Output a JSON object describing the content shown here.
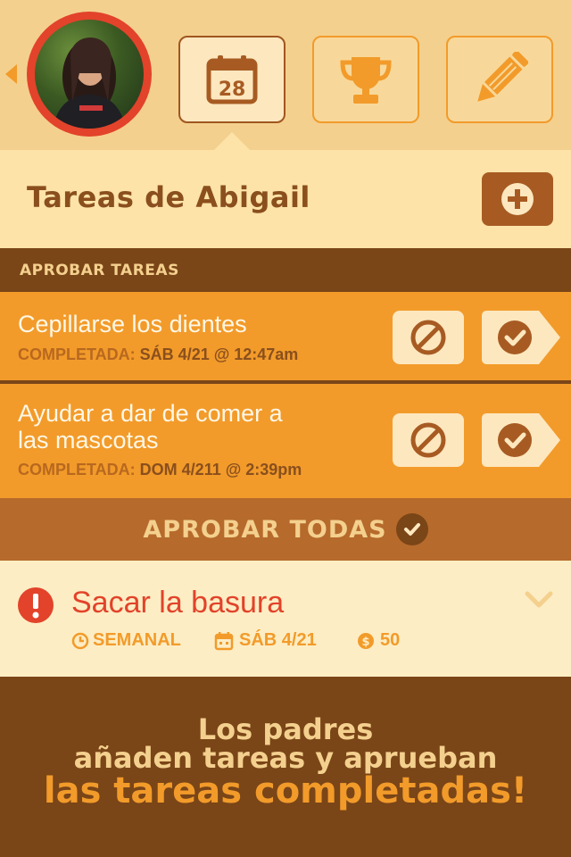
{
  "header": {
    "tabs": [
      {
        "name": "calendar",
        "icon": "calendar-icon",
        "badge": "28",
        "active": true
      },
      {
        "name": "trophy",
        "icon": "trophy-icon",
        "active": false
      },
      {
        "name": "edit",
        "icon": "pencil-icon",
        "active": false
      }
    ],
    "avatar": {
      "icon": "avatar-photo"
    }
  },
  "page": {
    "title": "Tareas de Abigail",
    "add_icon": "plus-circle-icon"
  },
  "section": {
    "label": "APROBAR TAREAS"
  },
  "tasks": [
    {
      "name": "Cepillarse los dientes",
      "status_label": "COMPLETADA:",
      "status_value": "SÁB 4/21 @ 12:47am"
    },
    {
      "name_line1": "Ayudar a dar de comer a",
      "name_line2": "las mascotas",
      "status_label": "COMPLETADA:",
      "status_value": "DOM 4/211 @ 2:39pm"
    }
  ],
  "approve_all": {
    "label": "APROBAR TODAS"
  },
  "chore": {
    "name": "Sacar la basura",
    "frequency": "SEMANAL",
    "date": "SÁB 4/21",
    "reward": "50"
  },
  "promo": {
    "line1": "Los padres",
    "line2": "añaden tareas y aprueban",
    "line3": "las tareas completadas!"
  },
  "colors": {
    "orange": "#f29b2a",
    "brown": "#7a4517",
    "cream": "#fde3a8",
    "red": "#e2432a"
  }
}
